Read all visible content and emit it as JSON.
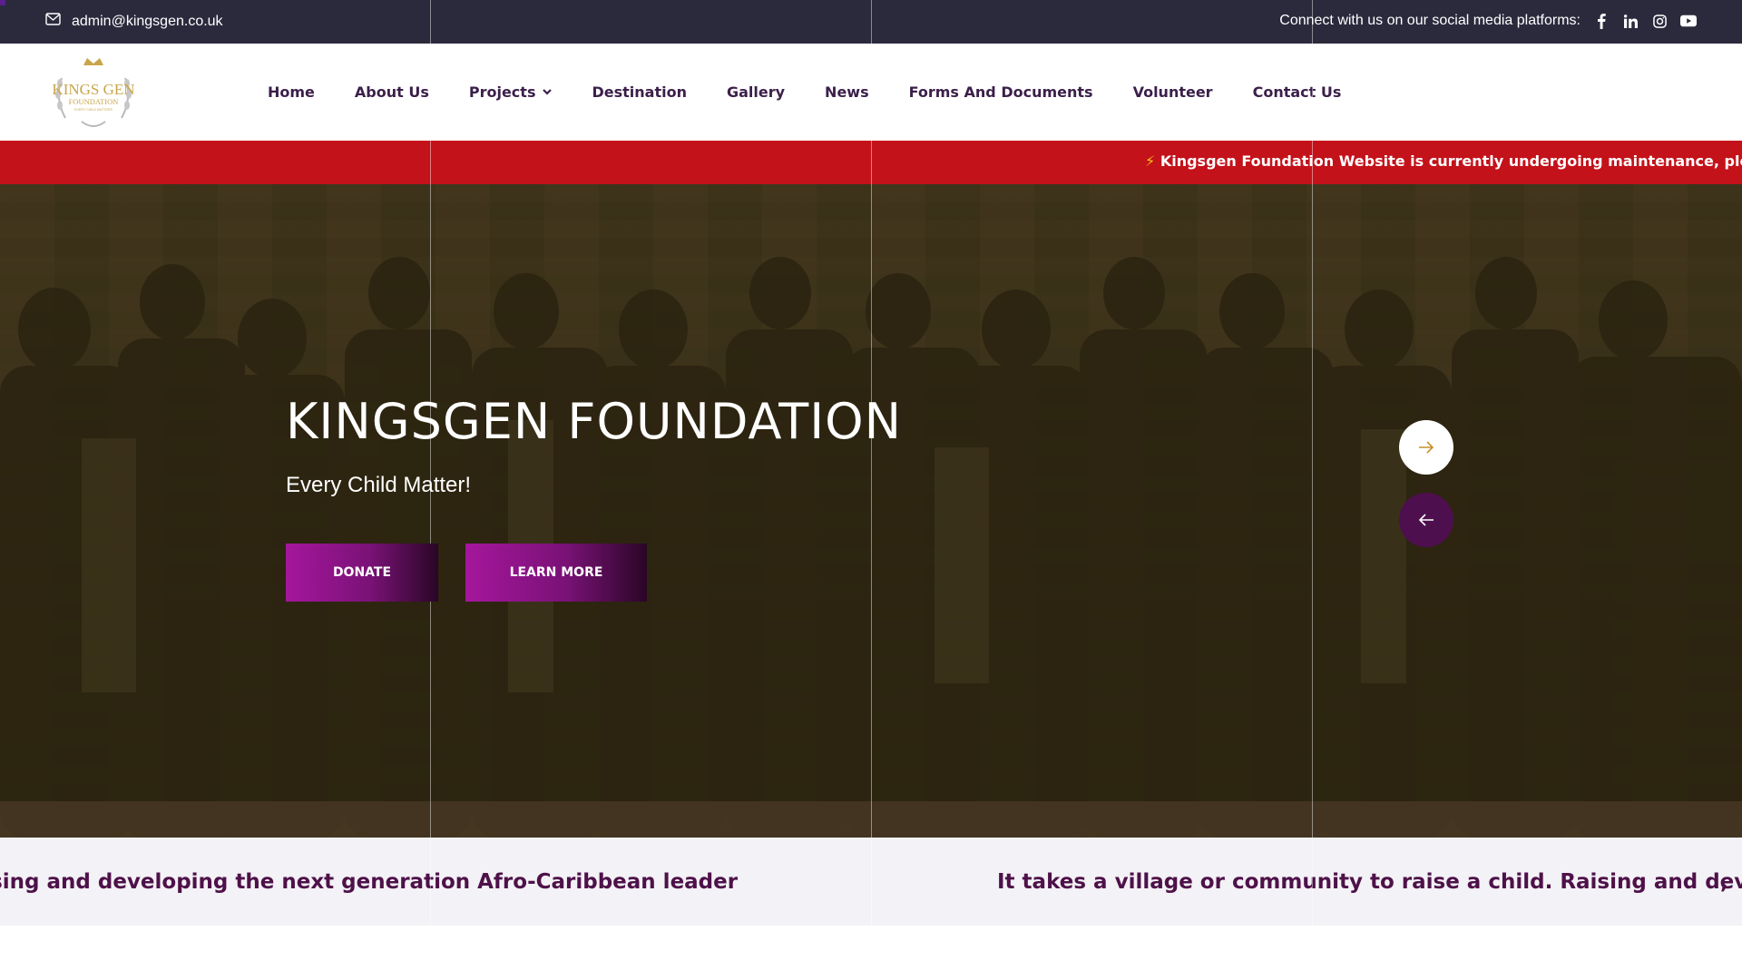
{
  "topbar": {
    "email": "admin@kingsgen.co.uk",
    "social_label": "Connect with us on our social media platforms:",
    "icons": [
      "facebook-icon",
      "linkedin-icon",
      "instagram-icon",
      "youtube-icon"
    ]
  },
  "nav": {
    "logo": {
      "line1": "KINGS GEN",
      "line2": "FOUNDATION",
      "line3": "EVERY CHILD MATTERS"
    },
    "items": [
      {
        "label": "Home"
      },
      {
        "label": "About Us"
      },
      {
        "label": "Projects",
        "has_dropdown": true
      },
      {
        "label": "Destination"
      },
      {
        "label": "Gallery"
      },
      {
        "label": "News"
      },
      {
        "label": "Forms And Documents"
      },
      {
        "label": "Volunteer"
      },
      {
        "label": "Contact Us"
      }
    ]
  },
  "ticker": {
    "icon": "⚡",
    "text": "Kingsgen Foundation Website is currently undergoing maintenance, please bear w"
  },
  "hero": {
    "title": "KINGSGEN FOUNDATION",
    "subtitle": "Every Child Matter!",
    "donate_label": "DONATE",
    "learn_label": "LEARN MORE",
    "next_icon": "arrow-right-icon",
    "prev_icon": "arrow-left-icon"
  },
  "marquee": {
    "segment1": "munity to raise a child. Raising and developing the next generation Afro-Caribbean leader",
    "segment2": "It takes a village or community to raise a child. Raising and developin",
    "trail": ","
  },
  "colors": {
    "topbar": "#2b2a3d",
    "ticker": "#c4121a",
    "nav_text": "#3b1f4a",
    "brand_purple": "#a5169c",
    "marquee_text": "#4e1149"
  }
}
